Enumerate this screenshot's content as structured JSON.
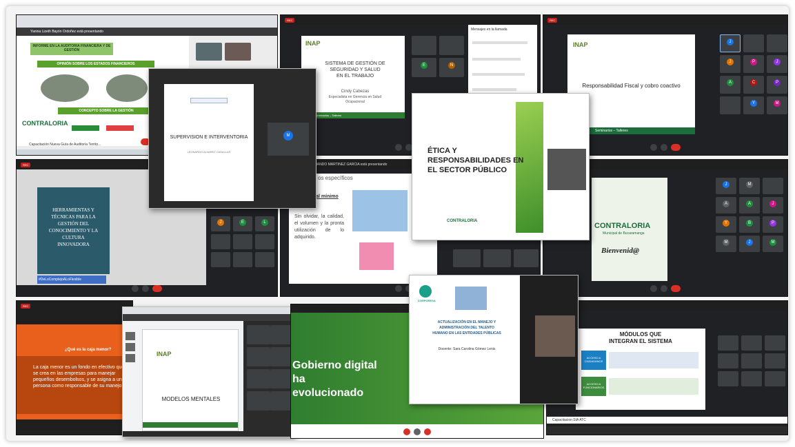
{
  "s1": {
    "bar": "Yanina Lizeth Bayón Ordoñez está presentando",
    "header": "INFORME EN LA AUDITORIA FINANCIERA Y DE GESTIÓN",
    "opinion": "OPINIÓN SOBRE LOS ESTADOS FINANCIEROS",
    "concepto": "CONCEPTO SOBRE LA GESTIÓN",
    "logo": "CONTRALORIA",
    "footer": "Capacitación Nueva Guía de Auditoría Territo..."
  },
  "s2": {
    "title_lines": [
      "SISTEMA DE GESTIÓN DE",
      "SEGURIDAD Y SALUD",
      "EN EL TRABAJO"
    ],
    "author": "Cindy Cabezas",
    "role_lines": [
      "Especialista en Gerencia en Salud",
      "Ocupacional"
    ],
    "panel_title": "Mensajes en la llamada",
    "strip": "Seminarios – Talleres"
  },
  "s3": {
    "logo": "INAP",
    "title": "Responsabilidad Fiscal y cobro coactivo",
    "strip": "Seminarios – Talleres"
  },
  "s4": {
    "title": "SUPERVISION E INTERVENTORIA",
    "subtitle": "LEONARDO ALVAREZ CASALLAS"
  },
  "s5": {
    "title_lines": [
      "ÉTICA Y",
      "RESPONSABILIDADES EN",
      "EL SECTOR PÚBLICO"
    ],
    "logos": "CONTRALORIA"
  },
  "s6": {
    "title_lines": [
      "HERRAMIENTAS Y",
      "TÉCNICAS PARA LA",
      "GESTIÓN DEL",
      "CONOCIMIENTO Y LA",
      "CULTURA",
      "INNOVADORA"
    ],
    "hashtag": "#DeLoComplejoALoFlexible"
  },
  "s7": {
    "heading": "Comprar al mínimo precio",
    "body": "Sin olvidar, la calidad, el volumen y la pronta utilización de lo adquirido.",
    "label": "os específicos",
    "bar": "DIEGO ARMANDO MARTINEZ GARCIA está presentando"
  },
  "s8": {
    "logo": "CONTRALORIA",
    "sub": "Municipal de Bucaramanga",
    "welcome": "Bienvenid@"
  },
  "s9": {
    "logo": "CORPGRESA",
    "title_lines": [
      "ACTUALIZACIÓN EN EL MANEJO Y",
      "ADMINISTRACIÓN DEL TALENTO",
      "HUMANO EN LAS ENTIDADES PÚBLICAS"
    ],
    "docente": "Docente: Sara Carolina Gómez Lenis"
  },
  "s10": {
    "question": "¿Qué es la  caja menor?",
    "body": "La caja menor es un fondo en efectivo que se crea en las empresas para manejar pequeños desembolsos, y se asigna a una persona como responsable de su manejo."
  },
  "s11": {
    "logo": "INAP",
    "title": "MODELOS MENTALES"
  },
  "s12": {
    "line1": "Gobierno digital",
    "line2": "ha",
    "line3": "evolucionado"
  },
  "s13": {
    "title_lines": [
      "MÓDULOS QUE",
      "INTEGRAN EL SISTEMA"
    ],
    "box1": "ACCESO A CIUDADANOS",
    "box2": "ACCESO A FUNCIONARIOS",
    "footer": "Capacitacion SIA ATC"
  },
  "colors": {
    "accent_red": "#d93025",
    "meet_dark": "#202124",
    "green": "#1b6e3a",
    "orange": "#e8601c"
  }
}
